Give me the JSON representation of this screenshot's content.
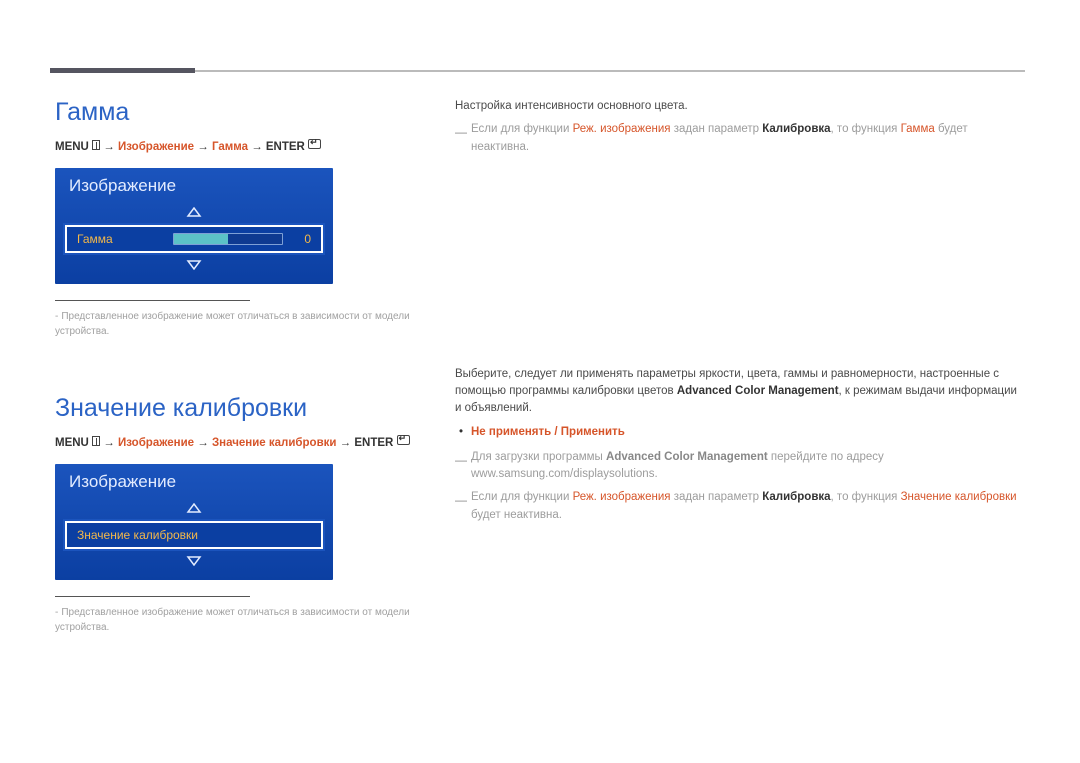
{
  "section1": {
    "title": "Гамма",
    "breadcrumb": {
      "menu_label": "MENU",
      "steps_highlight": "Изображение",
      "step2": "Гамма",
      "enter_label": "ENTER"
    },
    "ui_panel": {
      "header": "Изображение",
      "row_label": "Гамма",
      "row_value": "0"
    },
    "caption": "Представленное изображение может отличаться в зависимости от модели устройства."
  },
  "section2": {
    "title": "Значение калибровки",
    "breadcrumb": {
      "menu_label": "MENU",
      "steps_highlight": "Изображение",
      "step2": "Значение калибровки",
      "enter_label": "ENTER"
    },
    "ui_panel": {
      "header": "Изображение",
      "row_label": "Значение калибровки"
    },
    "caption": "Представленное изображение может отличаться в зависимости от модели устройства."
  },
  "right1": {
    "line1": "Настройка интенсивности основного цвета.",
    "note_prefix": "Если для функции ",
    "note_hl1": "Реж. изображения",
    "note_mid1": " задан параметр ",
    "note_bold1": "Калибровка",
    "note_mid2": ", то функция ",
    "note_hl2": "Гамма",
    "note_suffix": " будет неактивна."
  },
  "right2": {
    "para_pre": "Выберите, следует ли применять параметры яркости, цвета, гаммы и равномерности, настроенные с помощью программы калибровки цветов ",
    "para_bold": "Advanced Color Management",
    "para_post": ", к режимам выдачи информации и объявлений.",
    "bullet_opts": "Не применять / Применить",
    "note2_pre": "Для загрузки программы ",
    "note2_bold": "Advanced Color Management",
    "note2_mid": " перейдите по адресу www.samsung.com/displaysolutions.",
    "note3_prefix": "Если для функции ",
    "note3_hl1": "Реж. изображения",
    "note3_mid1": " задан параметр ",
    "note3_bold1": "Калибровка",
    "note3_mid2": ", то функция ",
    "note3_hl2": "Значение калибровки",
    "note3_suffix": " будет неактивна."
  }
}
